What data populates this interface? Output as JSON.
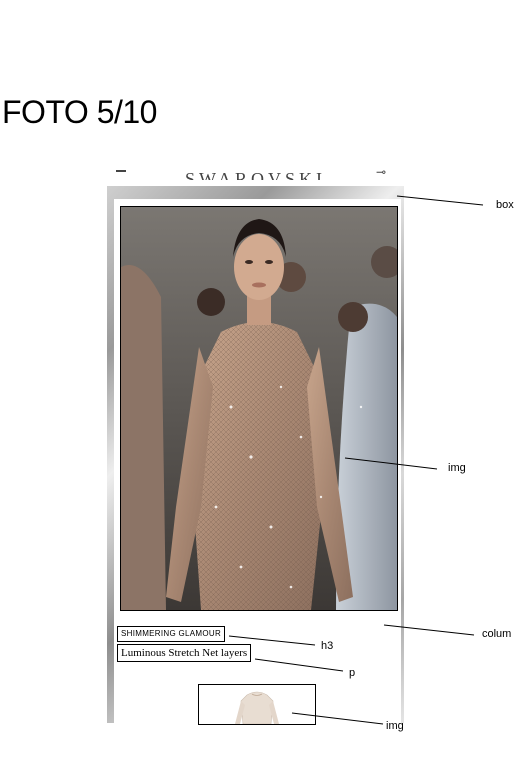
{
  "page": {
    "title": "FOTO 5/10"
  },
  "phone": {
    "brand": "SWAROVSKI",
    "cart_icon": "bag-icon",
    "menu_icon": "menu-icon"
  },
  "content": {
    "heading": "SHIMMERING GLAMOUR",
    "description": "Luminous Stretch Net layers"
  },
  "annotations": {
    "box": "box",
    "img_main": "img",
    "column": "colum",
    "h3": "h3",
    "p": "p",
    "img_thumb": "img"
  },
  "colors": {
    "background": "#ffffff",
    "outline": "#000000"
  }
}
